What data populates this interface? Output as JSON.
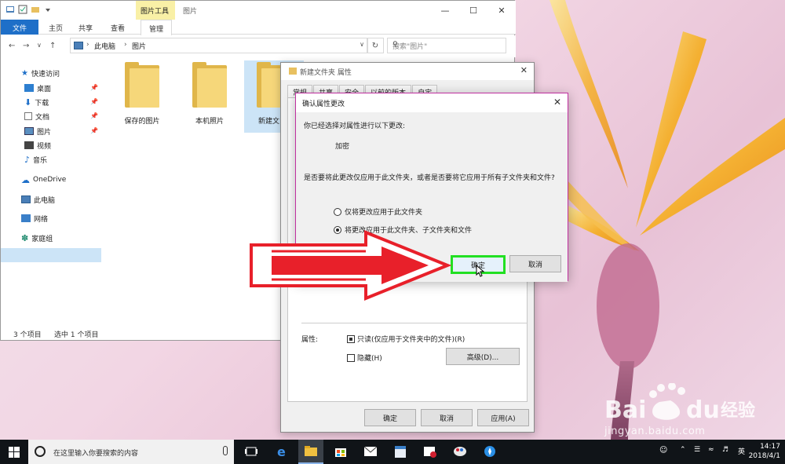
{
  "explorer": {
    "context_tab_group": "图片工具",
    "window_title": "图片",
    "ribbon_tabs": [
      "文件",
      "主页",
      "共享",
      "查看",
      "管理"
    ],
    "address_segments": [
      "此电脑",
      "图片"
    ],
    "search_placeholder": "搜索\"图片\"",
    "sidebar": {
      "quick_access": "快速访问",
      "items": [
        "桌面",
        "下载",
        "文档",
        "图片",
        "视频",
        "音乐"
      ],
      "onedrive": "OneDrive",
      "this_pc": "此电脑",
      "network": "网络",
      "homegroup": "家庭组"
    },
    "folders": [
      "保存的图片",
      "本机照片",
      "新建文"
    ],
    "status_count": "3 个项目",
    "status_selected": "选中 1 个项目"
  },
  "properties": {
    "title": "新建文件夹 属性",
    "tabs": [
      "常规",
      "共享",
      "安全",
      "以前的版本",
      "自定"
    ],
    "attributes_label": "属性:",
    "readonly_label": "只读(仅应用于文件夹中的文件)(R)",
    "hidden_label": "隐藏(H)",
    "advanced_button": "高级(D)...",
    "ok": "确定",
    "cancel": "取消",
    "apply": "应用(A)"
  },
  "confirm": {
    "title": "确认属性更改",
    "intro": "你已经选择对属性进行以下更改:",
    "change": "加密",
    "question": "是否要将此更改仅应用于此文件夹，或者是否要将它应用于所有子文件夹和文件?",
    "option_folder_only": "仅将更改应用于此文件夹",
    "option_all": "将更改应用于此文件夹、子文件夹和文件",
    "ok": "确定",
    "cancel": "取消",
    "selected_option": "option_all"
  },
  "taskbar": {
    "search_placeholder": "在这里输入你要搜索的内容",
    "ime": "英",
    "time": "14:17",
    "date": "2018/4/1"
  },
  "watermark": {
    "brand": "Bai du 经验",
    "url": "jingyan.baidu.com"
  },
  "colors": {
    "accent": "#1e6fc8",
    "highlight_green": "#22e022",
    "arrow_red": "#e8202a"
  }
}
